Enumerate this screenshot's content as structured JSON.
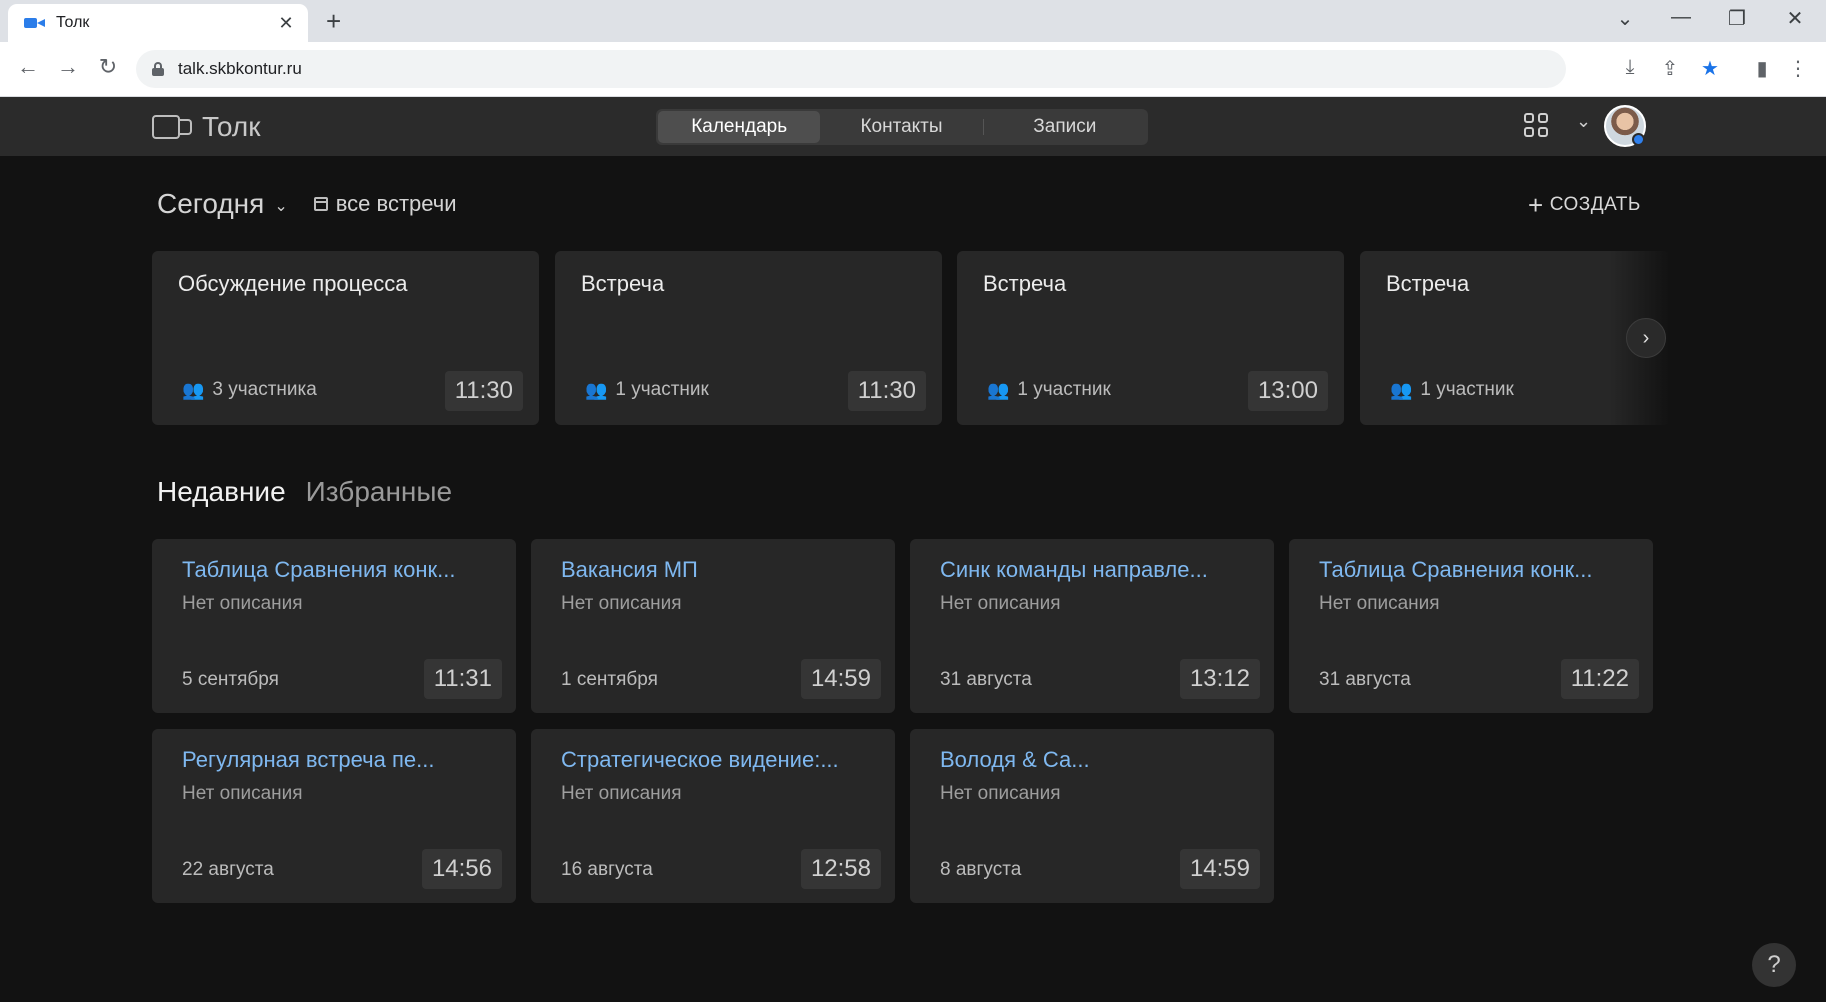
{
  "browser": {
    "tab_title": "Толк",
    "tab_close": "✕",
    "new_tab": "+",
    "window_controls": {
      "tabs_menu": "⌄",
      "minimize": "—",
      "restore": "❐",
      "close": "✕"
    },
    "nav": {
      "back": "←",
      "forward": "→",
      "reload": "↻"
    },
    "url": "talk.skbkontur.ru",
    "toolbar_icons": {
      "install": "⤓",
      "share": "⇪",
      "bookmark": "★",
      "sidepanel": "▮",
      "menu": "⋮"
    }
  },
  "header": {
    "logo_text": "Толк",
    "nav_tabs": [
      {
        "label": "Календарь",
        "active": true
      },
      {
        "label": "Контакты",
        "active": false
      },
      {
        "label": "Записи",
        "active": false
      }
    ],
    "user_chevron": "⌄",
    "icons": [
      "video-camera-icon",
      "apps-grid-icon",
      "chevron-down-icon",
      "avatar"
    ]
  },
  "today": {
    "title": "Сегодня",
    "chevron": "⌄",
    "all_meetings_label": "все встречи",
    "create_label": "СОЗДАТЬ",
    "create_plus": "+",
    "people_glyph": "👥",
    "next_arrow": "›",
    "meetings": [
      {
        "title": "Обсуждение процесса",
        "participants": "3 участника",
        "time": "11:30"
      },
      {
        "title": "Встреча",
        "participants": "1 участник",
        "time": "11:30"
      },
      {
        "title": "Встреча",
        "participants": "1 участник",
        "time": "13:00"
      },
      {
        "title": "Встреча",
        "participants": "1 участник",
        "time": ""
      }
    ]
  },
  "lists": {
    "tabs": [
      {
        "label": "Недавние",
        "active": true
      },
      {
        "label": "Избранные",
        "active": false
      }
    ],
    "recent": [
      {
        "title": "Таблица Сравнения конк...",
        "description": "Нет описания",
        "date": "5 сентября",
        "time": "11:31"
      },
      {
        "title": "Вакансия МП",
        "description": "Нет описания",
        "date": "1 сентября",
        "time": "14:59"
      },
      {
        "title": "Синк команды направле...",
        "description": "Нет описания",
        "date": "31 августа",
        "time": "13:12"
      },
      {
        "title": "Таблица Сравнения конк...",
        "description": "Нет описания",
        "date": "31 августа",
        "time": "11:22"
      },
      {
        "title": "Регулярная встреча пе...",
        "description": "Нет описания",
        "date": "22 августа",
        "time": "14:56"
      },
      {
        "title": "Стратегическое видение:...",
        "description": "Нет описания",
        "date": "16 августа",
        "time": "12:58"
      },
      {
        "title": "Володя & Са...",
        "description": "Нет описания",
        "date": "8 августа",
        "time": "14:59"
      }
    ]
  },
  "help_label": "?",
  "colors": {
    "background": "#121212",
    "card": "#272727",
    "header": "#2b2b2b",
    "link": "#7fb8f0",
    "accent_blue": "#2f80ed"
  }
}
